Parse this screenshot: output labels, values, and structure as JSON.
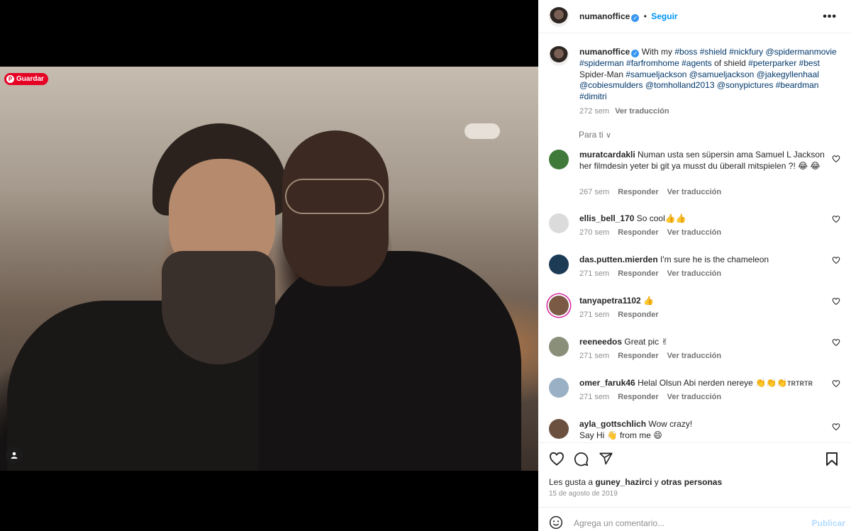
{
  "media": {
    "save_label": "Guardar",
    "pin_glyph": "P"
  },
  "header": {
    "username": "numanoffice",
    "verified_glyph": "✓",
    "separator": "•",
    "follow_label": "Seguir",
    "more_label": "•••"
  },
  "caption": {
    "username": "numanoffice",
    "verified_glyph": "✓",
    "segments": [
      {
        "t": "With my ",
        "tag": false
      },
      {
        "t": "#boss",
        "tag": true
      },
      {
        "t": " ",
        "tag": false
      },
      {
        "t": "#shield",
        "tag": true
      },
      {
        "t": " ",
        "tag": false
      },
      {
        "t": "#nickfury",
        "tag": true
      },
      {
        "t": " ",
        "tag": false
      },
      {
        "t": "@spidermanmovie",
        "tag": true
      },
      {
        "t": " ",
        "tag": false
      },
      {
        "t": "#spiderman",
        "tag": true
      },
      {
        "t": " ",
        "tag": false
      },
      {
        "t": "#farfromhome",
        "tag": true
      },
      {
        "t": " ",
        "tag": false
      },
      {
        "t": "#agents",
        "tag": true
      },
      {
        "t": " of shield ",
        "tag": false
      },
      {
        "t": "#peterparker",
        "tag": true
      },
      {
        "t": " ",
        "tag": false
      },
      {
        "t": "#best",
        "tag": true
      },
      {
        "t": " Spider-Man ",
        "tag": false
      },
      {
        "t": "#samueljackson",
        "tag": true
      },
      {
        "t": " ",
        "tag": false
      },
      {
        "t": "@samueljackson",
        "tag": true
      },
      {
        "t": " ",
        "tag": false
      },
      {
        "t": "@jakegyllenhaal",
        "tag": true
      },
      {
        "t": " ",
        "tag": false
      },
      {
        "t": "@cobiesmulders",
        "tag": true
      },
      {
        "t": " ",
        "tag": false
      },
      {
        "t": "@tomholland2013",
        "tag": true
      },
      {
        "t": " ",
        "tag": false
      },
      {
        "t": "@sonypictures",
        "tag": true
      },
      {
        "t": " ",
        "tag": false
      },
      {
        "t": "#beardman",
        "tag": true
      },
      {
        "t": " ",
        "tag": false
      },
      {
        "t": "#dimitri",
        "tag": true
      }
    ],
    "time": "272 sem",
    "translate": "Ver traducción"
  },
  "filter": {
    "label": "Para ti",
    "chevron": "∨"
  },
  "comments": [
    {
      "user": "muratcardakli",
      "text": "Numan usta sen süpersin ama Samuel L Jackson her filmdesin yeter bi git ya musst du überall mitspielen ?! 😂 😂",
      "time": "267 sem",
      "reply": "Responder",
      "translate": "Ver traducción",
      "avatar_color": "#3f7a3a"
    },
    {
      "user": "ellis_bell_170",
      "text": "So cool👍👍",
      "time": "270 sem",
      "reply": "Responder",
      "translate": "Ver traducción",
      "avatar_color": "#dbdbdb"
    },
    {
      "user": "das.putten.mierden",
      "text": "I'm sure he is the chameleon",
      "time": "271 sem",
      "reply": "Responder",
      "translate": "Ver traducción",
      "avatar_color": "#1c3b55"
    },
    {
      "user": "tanyapetra1102",
      "text": "👍",
      "time": "271 sem",
      "reply": "Responder",
      "translate": "",
      "avatar_color": "#7a5a44"
    },
    {
      "user": "reeneedos",
      "text": "Great pic ✌",
      "time": "271 sem",
      "reply": "Responder",
      "translate": "Ver traducción",
      "avatar_color": "#8a8f7a"
    },
    {
      "user": "omer_faruk46",
      "text": "Helal Olsun Abi nerden nereye 👏👏👏ᴛʀᴛʀᴛʀ",
      "time": "271 sem",
      "reply": "Responder",
      "translate": "Ver traducción",
      "avatar_color": "#9ab0c4"
    },
    {
      "user": "ayla_gottschlich",
      "text": "Wow crazy!\nSay Hi 👋 from me 😄",
      "time": "",
      "reply": "",
      "translate": "",
      "avatar_color": "#6b5040"
    }
  ],
  "likes": {
    "prefix": "Les gusta a ",
    "user": "guney_hazirci",
    "middle": " y ",
    "others": "otras personas"
  },
  "date": "15 de agosto de 2019",
  "comment_input": {
    "placeholder": "Agrega un comentario...",
    "publish_label": "Publicar"
  },
  "colors": {
    "link": "#00376b",
    "follow": "#0095f6",
    "verified": "#3897f0",
    "pinterest": "#e60023"
  }
}
